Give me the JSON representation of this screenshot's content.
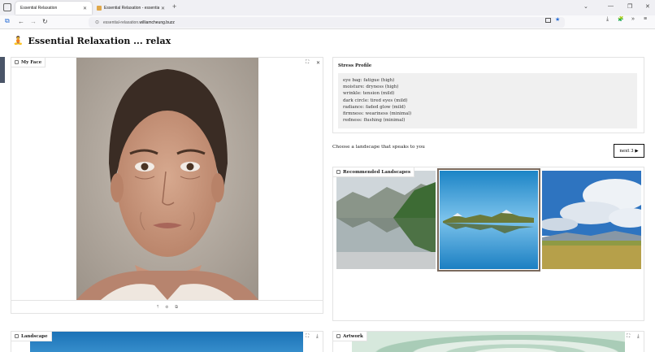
{
  "browser": {
    "tabs": [
      {
        "title": "Essential Relaxation",
        "active": true
      },
      {
        "title": "Essential Relaxation - essential",
        "active": false
      }
    ],
    "url_prefix": "essential-relaxation.",
    "url_host": "williamcheung.buzz",
    "icons": {
      "sidebar": "sidebar-icon",
      "new_tab": "+",
      "list_all_tabs": "⌄",
      "minimize": "—",
      "restore": "❐",
      "close": "✕",
      "back": "←",
      "forward": "→",
      "reload": "↻",
      "reader": "reader-icon",
      "bookmark": "★",
      "downloads": "⤓",
      "extensions": "🧩",
      "overflow": "»",
      "menu": "≡"
    }
  },
  "page": {
    "title": "Essential Relaxation ... relax",
    "title_icon": "🧘"
  },
  "my_face": {
    "label": "My Face",
    "footer_icons": [
      "⤒",
      "⊚",
      "⧉"
    ]
  },
  "stress_profile": {
    "title": "Stress Profile",
    "lines": [
      "eye bag: fatigue (high)",
      "moisture: dryness (high)",
      "wrinkle: tension (mild)",
      "dark circle: tired eyes (mild)",
      "radiance: faded glow (mild)",
      "firmness: weariness (minimal)",
      "redness: flushing (minimal)"
    ]
  },
  "choose": {
    "prompt": "Choose a landscape that speaks to you",
    "next_label": "next 3 ▶"
  },
  "recommended": {
    "label": "Recommended Landscapes",
    "selected_index": 1,
    "images": [
      "mountain-lake-reflection",
      "blue-lake-mountain-reflection",
      "cloudy-sky-meadow"
    ]
  },
  "landscape": {
    "label": "Landscape"
  },
  "artwork": {
    "label": "Artwork"
  },
  "colors": {
    "accent_selected": "#7a6a5e",
    "bookmark_star": "#2b6fd6"
  }
}
